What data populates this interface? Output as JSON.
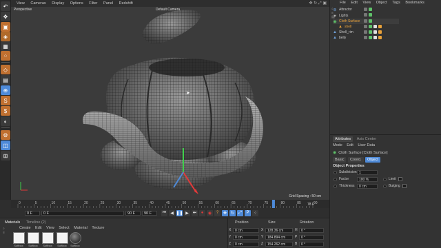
{
  "menubar": {
    "items": [
      "View",
      "Cameras",
      "Display",
      "Options",
      "Filter",
      "Panel",
      "Redshift"
    ]
  },
  "viewport": {
    "name": "Perspective",
    "camera": "Default Camera",
    "grid_spacing": "Grid Spacing : 50 cm"
  },
  "object_manager": {
    "menu": [
      "File",
      "Edit",
      "View",
      "Object",
      "Tags",
      "Bookmarks"
    ],
    "objects": [
      {
        "name": "Attractor",
        "icon": "attractor-icon",
        "color": "#6fa0d8"
      },
      {
        "name": "Lights",
        "icon": "light-icon",
        "color": "#dcdcdc"
      },
      {
        "name": "Cloth Surface",
        "icon": "cloth-surface-icon",
        "color": "#5fc26a",
        "selected": true
      },
      {
        "name": "shell",
        "icon": "polygon-object-icon",
        "color": "#e8a13a"
      },
      {
        "name": "Shell_rim",
        "icon": "polygon-object-icon",
        "color": "#6fa0d8"
      },
      {
        "name": "belly",
        "icon": "polygon-object-icon",
        "color": "#6fa0d8"
      }
    ]
  },
  "attributes": {
    "tabs": [
      "Attributes",
      "Axis Center"
    ],
    "menu": [
      "Mode",
      "Edit",
      "User Data"
    ],
    "title": "Cloth Surface [Cloth Surface]",
    "sub_tabs": [
      "Basic",
      "Coord.",
      "Object"
    ],
    "active_sub_tab": "Object",
    "section": "Object Properties",
    "subdivisions_label": "Subdivisions",
    "subdivisions_value": "1",
    "factor_label": "Factor",
    "factor_value": "100 %",
    "limit_label": "Limit",
    "thickness_label": "Thickness",
    "thickness_value": "0 cm",
    "bulging_label": "Bulging"
  },
  "timeline": {
    "ticks": [
      "0",
      "5",
      "10",
      "15",
      "20",
      "25",
      "30",
      "35",
      "40",
      "45",
      "50",
      "55",
      "60",
      "65",
      "70",
      "75",
      "80",
      "85",
      "90"
    ],
    "current_frame": "78 F",
    "playhead_frame": 78,
    "start_field": "0 F",
    "start_field2": "0 F",
    "end_field": "90 F",
    "end_field2": "90 F"
  },
  "materials": {
    "tabs": [
      "Materials",
      "Timeline (2)"
    ],
    "menu": [
      "Create",
      "Edit",
      "View",
      "Select",
      "Material",
      "Texture"
    ],
    "items": [
      "Softbox",
      "Softbox",
      "Softbox",
      "Softbox",
      "Softbox"
    ]
  },
  "coordinates": {
    "headers": [
      "Position",
      "Size",
      "Rotation"
    ],
    "rows": [
      {
        "axis": "X",
        "pos": "0 cm",
        "size_axis": "X",
        "size": "128.36 cm",
        "rot_axis": "H",
        "rot": "0 °"
      },
      {
        "axis": "Y",
        "pos": "0 cm",
        "size_axis": "Y",
        "size": "184.894 cm",
        "rot_axis": "P",
        "rot": "0 °"
      },
      {
        "axis": "Z",
        "pos": "0 cm",
        "size_axis": "Z",
        "size": "154.262 cm",
        "rot_axis": "B",
        "rot": "0 °"
      }
    ]
  },
  "colors": {
    "accent": "#4e8ad8",
    "selected_object": "#5fc26a",
    "panel": "#333333",
    "viewport_bg": "#3a3a3a"
  }
}
